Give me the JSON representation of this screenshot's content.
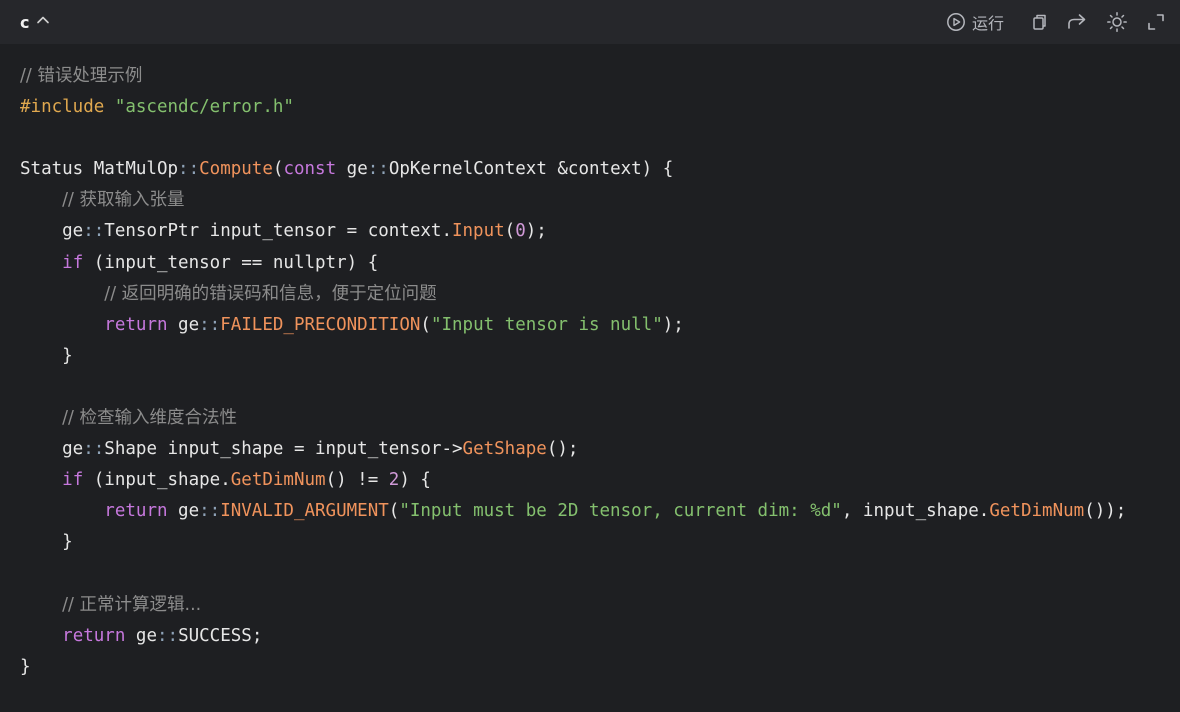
{
  "header": {
    "language": "c",
    "run_label": "运行"
  },
  "icons": {
    "collapse": "chevron-up-icon",
    "run": "play-circle-icon",
    "copy": "copy-icon",
    "share": "share-arrow-icon",
    "theme": "sun-icon",
    "fullscreen": "expand-icon"
  },
  "colors": {
    "background": "#1e1f22",
    "header": "#26272b",
    "comment": "#8c8c8c",
    "preprocessor": "#e0a84f",
    "string": "#84c06e",
    "keyword": "#c678dd",
    "function": "#f0935c",
    "number": "#d19ad8",
    "plain": "#e6e6e6"
  },
  "code": {
    "lines": [
      [
        {
          "t": "// 错误处理示例",
          "c": "comment"
        }
      ],
      [
        {
          "t": "#include ",
          "c": "pre"
        },
        {
          "t": "\"ascendc/error.h\"",
          "c": "string"
        }
      ],
      [],
      [
        {
          "t": "Status MatMulOp",
          "c": "plain"
        },
        {
          "t": "::",
          "c": "op"
        },
        {
          "t": "Compute",
          "c": "func"
        },
        {
          "t": "(",
          "c": "plain"
        },
        {
          "t": "const",
          "c": "keyword"
        },
        {
          "t": " ge",
          "c": "plain"
        },
        {
          "t": "::",
          "c": "op"
        },
        {
          "t": "OpKernelContext &context) {",
          "c": "plain"
        }
      ],
      [
        {
          "t": "    ",
          "c": "plain"
        },
        {
          "t": "// 获取输入张量",
          "c": "comment"
        }
      ],
      [
        {
          "t": "    ge",
          "c": "plain"
        },
        {
          "t": "::",
          "c": "op"
        },
        {
          "t": "TensorPtr input_tensor = context.",
          "c": "plain"
        },
        {
          "t": "Input",
          "c": "func"
        },
        {
          "t": "(",
          "c": "plain"
        },
        {
          "t": "0",
          "c": "number"
        },
        {
          "t": ");",
          "c": "plain"
        }
      ],
      [
        {
          "t": "    ",
          "c": "plain"
        },
        {
          "t": "if",
          "c": "keyword"
        },
        {
          "t": " (input_tensor == nullptr) {",
          "c": "plain"
        }
      ],
      [
        {
          "t": "        ",
          "c": "plain"
        },
        {
          "t": "// 返回明确的错误码和信息，便于定位问题",
          "c": "comment"
        }
      ],
      [
        {
          "t": "        ",
          "c": "plain"
        },
        {
          "t": "return",
          "c": "keyword"
        },
        {
          "t": " ge",
          "c": "plain"
        },
        {
          "t": "::",
          "c": "op"
        },
        {
          "t": "FAILED_PRECONDITION",
          "c": "func"
        },
        {
          "t": "(",
          "c": "plain"
        },
        {
          "t": "\"Input tensor is null\"",
          "c": "string"
        },
        {
          "t": ");",
          "c": "plain"
        }
      ],
      [
        {
          "t": "    }",
          "c": "plain"
        }
      ],
      [],
      [
        {
          "t": "    ",
          "c": "plain"
        },
        {
          "t": "// 检查输入维度合法性",
          "c": "comment"
        }
      ],
      [
        {
          "t": "    ge",
          "c": "plain"
        },
        {
          "t": "::",
          "c": "op"
        },
        {
          "t": "Shape input_shape = input_tensor->",
          "c": "plain"
        },
        {
          "t": "GetShape",
          "c": "func"
        },
        {
          "t": "();",
          "c": "plain"
        }
      ],
      [
        {
          "t": "    ",
          "c": "plain"
        },
        {
          "t": "if",
          "c": "keyword"
        },
        {
          "t": " (input_shape.",
          "c": "plain"
        },
        {
          "t": "GetDimNum",
          "c": "func"
        },
        {
          "t": "() != ",
          "c": "plain"
        },
        {
          "t": "2",
          "c": "number"
        },
        {
          "t": ") {",
          "c": "plain"
        }
      ],
      [
        {
          "t": "        ",
          "c": "plain"
        },
        {
          "t": "return",
          "c": "keyword"
        },
        {
          "t": " ge",
          "c": "plain"
        },
        {
          "t": "::",
          "c": "op"
        },
        {
          "t": "INVALID_ARGUMENT",
          "c": "func"
        },
        {
          "t": "(",
          "c": "plain"
        },
        {
          "t": "\"Input must be 2D tensor, current dim: %d\"",
          "c": "string"
        },
        {
          "t": ", input_shape.",
          "c": "plain"
        },
        {
          "t": "GetDimNum",
          "c": "func"
        },
        {
          "t": "());",
          "c": "plain"
        }
      ],
      [
        {
          "t": "    }",
          "c": "plain"
        }
      ],
      [],
      [
        {
          "t": "    ",
          "c": "plain"
        },
        {
          "t": "// 正常计算逻辑...",
          "c": "comment"
        }
      ],
      [
        {
          "t": "    ",
          "c": "plain"
        },
        {
          "t": "return",
          "c": "keyword"
        },
        {
          "t": " ge",
          "c": "plain"
        },
        {
          "t": "::",
          "c": "op"
        },
        {
          "t": "SUCCESS;",
          "c": "plain"
        }
      ],
      [
        {
          "t": "}",
          "c": "plain"
        }
      ]
    ]
  }
}
